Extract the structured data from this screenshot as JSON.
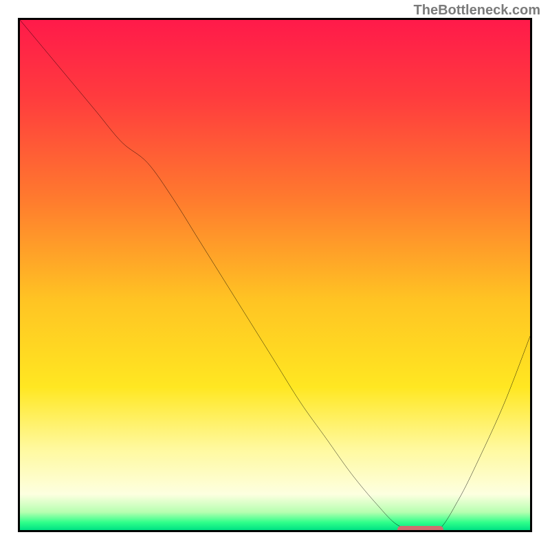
{
  "watermark": "TheBottleneck.com",
  "colors": {
    "frame": "#000000",
    "marker": "#cf6d6f",
    "gradient_stops": [
      {
        "offset": 0.0,
        "color": "#ff1a4a"
      },
      {
        "offset": 0.15,
        "color": "#ff3b3e"
      },
      {
        "offset": 0.35,
        "color": "#ff7a2e"
      },
      {
        "offset": 0.55,
        "color": "#ffc423"
      },
      {
        "offset": 0.72,
        "color": "#ffe722"
      },
      {
        "offset": 0.84,
        "color": "#fff99e"
      },
      {
        "offset": 0.93,
        "color": "#fdffe0"
      },
      {
        "offset": 0.965,
        "color": "#b6ffb0"
      },
      {
        "offset": 0.985,
        "color": "#2fff8a"
      },
      {
        "offset": 1.0,
        "color": "#00e184"
      }
    ]
  },
  "chart_data": {
    "type": "line",
    "title": "",
    "xlabel": "",
    "ylabel": "",
    "xlim": [
      0,
      100
    ],
    "ylim": [
      0,
      100
    ],
    "x": [
      0,
      5,
      10,
      15,
      20,
      25,
      30,
      35,
      40,
      45,
      50,
      55,
      60,
      65,
      70,
      74,
      78,
      82,
      86,
      90,
      95,
      100
    ],
    "y": [
      100,
      94,
      88,
      82,
      76,
      72,
      65,
      57,
      49,
      41,
      33,
      25,
      18,
      11,
      5,
      1,
      0,
      0,
      6,
      14,
      25,
      38
    ],
    "optimal_range_x": [
      74,
      83
    ]
  }
}
